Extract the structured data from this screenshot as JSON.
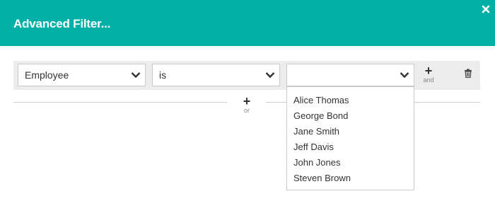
{
  "dialog": {
    "title": "Advanced Filter...",
    "close_icon": "close-icon",
    "header_color": "#00b0a7"
  },
  "filter": {
    "field": "Employee",
    "operator": "is",
    "value": "",
    "and_label": "and",
    "or_label": "or",
    "add_icon": "plus-icon",
    "delete_icon": "trash-icon",
    "value_options": [
      "Alice Thomas",
      "George Bond",
      "Jane Smith",
      "Jeff Davis",
      "John Jones",
      "Steven Brown"
    ]
  }
}
